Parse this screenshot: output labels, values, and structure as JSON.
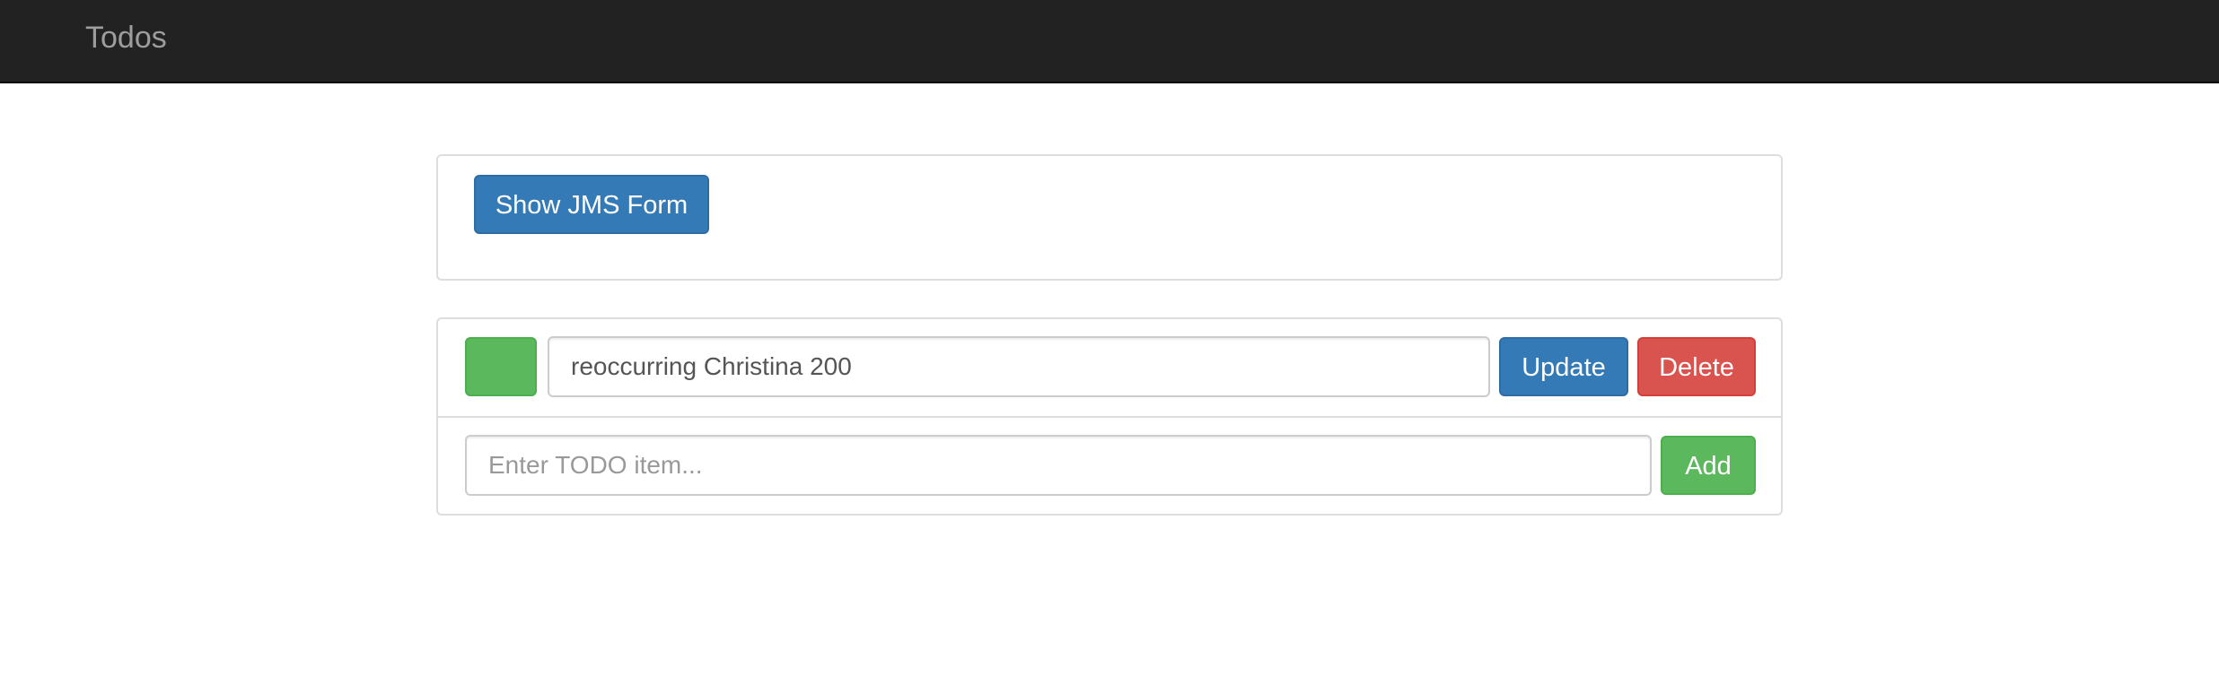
{
  "navbar": {
    "brand": "Todos"
  },
  "top_panel": {
    "show_form_label": "Show JMS Form"
  },
  "todo_list": {
    "items": [
      {
        "text": "reoccurring Christina 200",
        "done": true,
        "update_label": "Update",
        "delete_label": "Delete"
      }
    ],
    "new_item": {
      "value": "",
      "placeholder": "Enter TODO item...",
      "add_label": "Add"
    }
  },
  "colors": {
    "navbar_bg": "#222222",
    "brand_text": "#9d9d9d",
    "primary": "#337ab7",
    "success": "#5cb85c",
    "danger": "#d9534f",
    "panel_border": "#dddddd"
  }
}
